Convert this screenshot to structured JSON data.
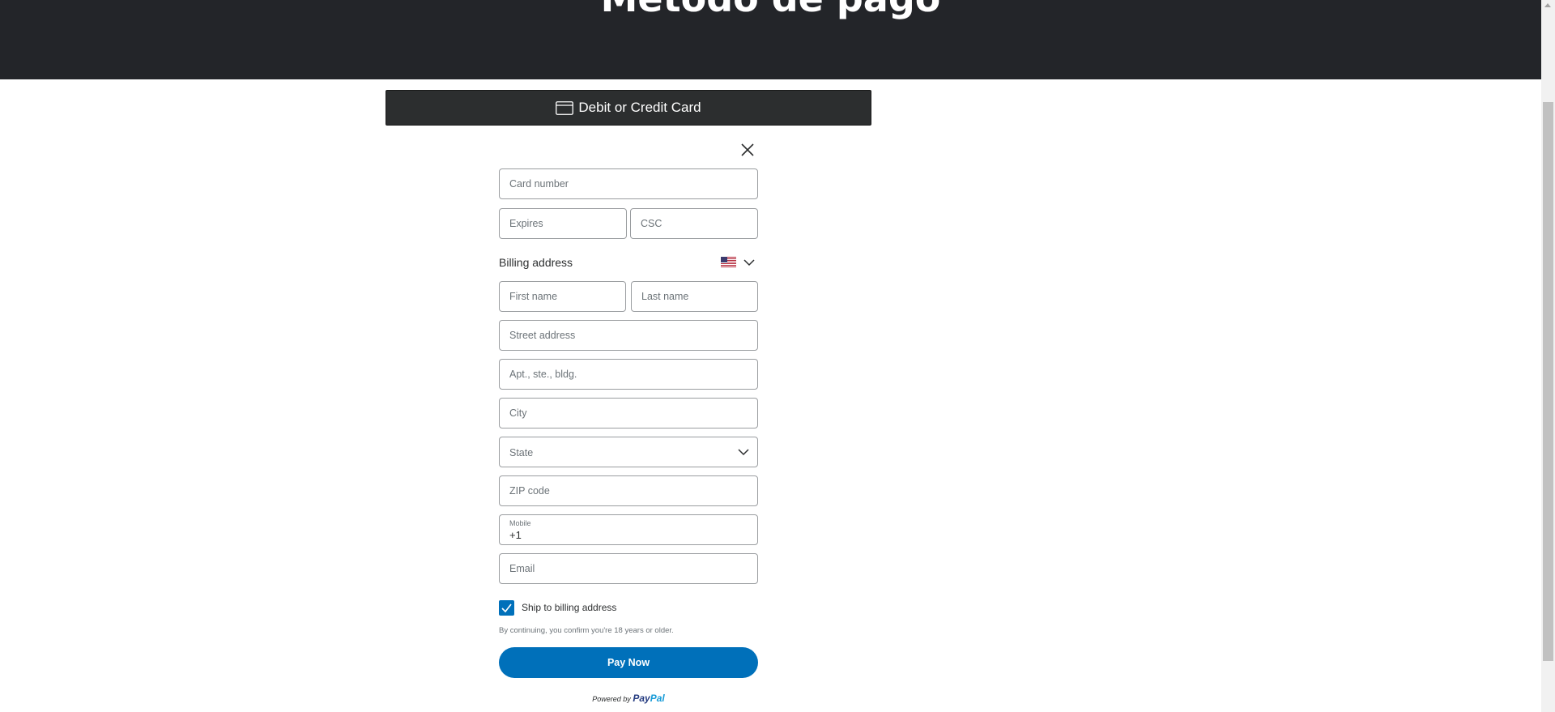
{
  "header": {
    "title": "Método de pago"
  },
  "payment_option": {
    "label": "Debit or Credit Card",
    "icon": "credit-card-icon"
  },
  "form": {
    "card_number_placeholder": "Card number",
    "expires_placeholder": "Expires",
    "csc_placeholder": "CSC",
    "billing_label": "Billing address",
    "country_flag": "us-flag-icon",
    "first_name_placeholder": "First name",
    "last_name_placeholder": "Last name",
    "street_placeholder": "Street address",
    "apt_placeholder": "Apt., ste., bldg.",
    "city_placeholder": "City",
    "state_label": "State",
    "zip_placeholder": "ZIP code",
    "mobile_label": "Mobile",
    "mobile_prefix": "+1",
    "email_placeholder": "Email",
    "ship_to_billing_label": "Ship to billing address",
    "ship_to_billing_checked": true,
    "legal_text": "By continuing, you confirm you're 18 years or older.",
    "pay_button_label": "Pay Now",
    "powered_by": "Powered by",
    "paypal_pay": "Pay",
    "paypal_pal": "Pal"
  },
  "colors": {
    "header_bg": "#232529",
    "card_bar_bg": "#2c2e2f",
    "primary_blue": "#0070ba",
    "paypal_dark": "#253b80",
    "paypal_light": "#179bd7"
  }
}
